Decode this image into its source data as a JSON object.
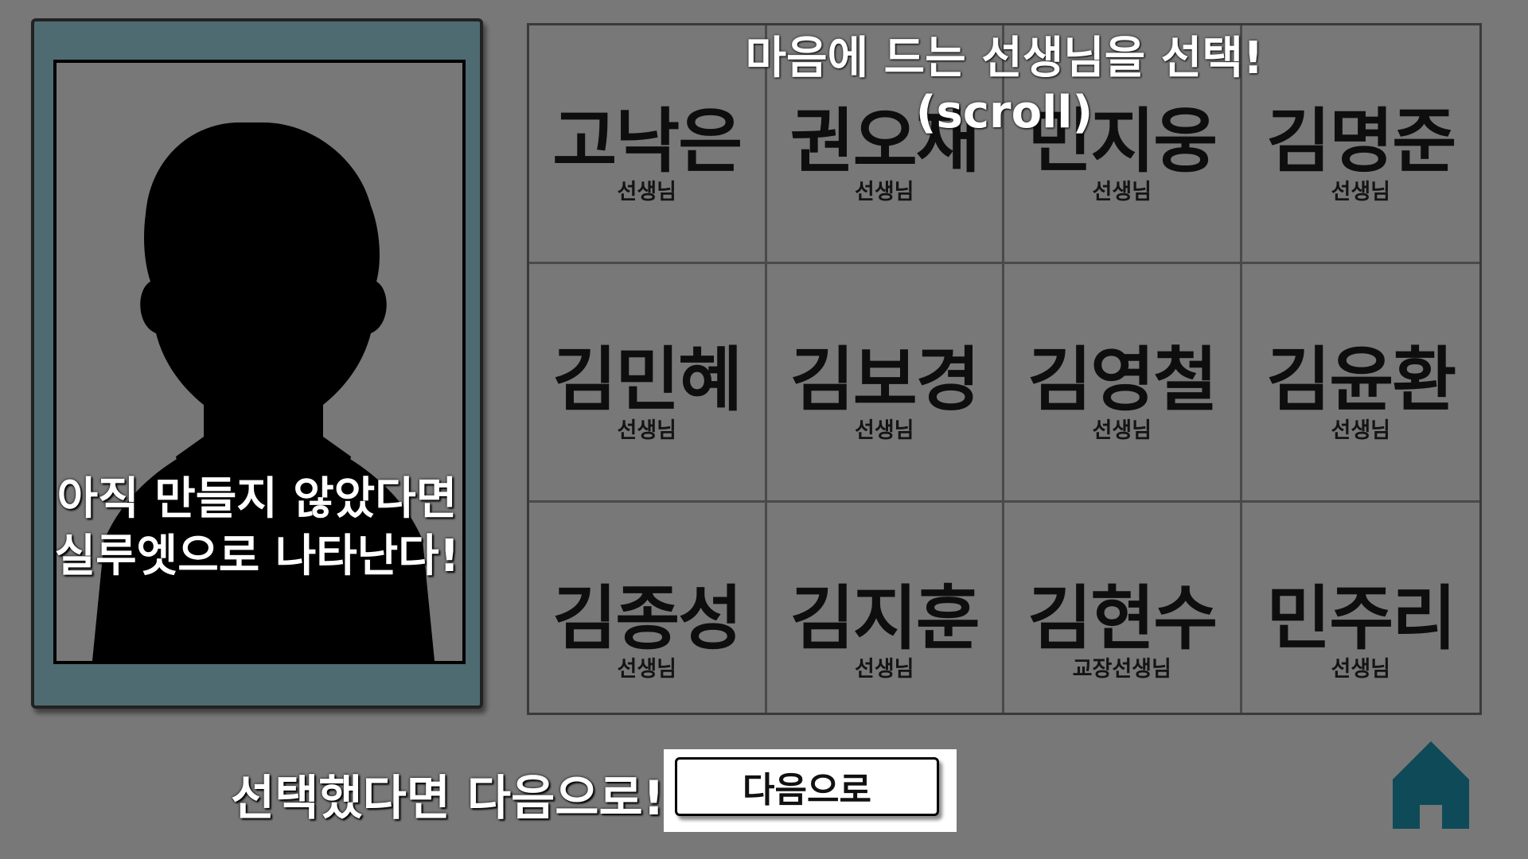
{
  "portrait": {
    "note_lines": [
      "아직 만들지 않았다면",
      "실루엣으로 나타난다!"
    ],
    "frame_color": "#4f6b72"
  },
  "header": {
    "line1": "마음에 드는 선생님을 선택!",
    "line2": "(scroll)"
  },
  "teachers": [
    {
      "name": "고낙은",
      "title": "선생님"
    },
    {
      "name": "권오재",
      "title": "선생님"
    },
    {
      "name": "민지웅",
      "title": "선생님"
    },
    {
      "name": "김명준",
      "title": "선생님"
    },
    {
      "name": "김민혜",
      "title": "선생님"
    },
    {
      "name": "김보경",
      "title": "선생님"
    },
    {
      "name": "김영철",
      "title": "선생님"
    },
    {
      "name": "김윤환",
      "title": "선생님"
    },
    {
      "name": "김종성",
      "title": "선생님"
    },
    {
      "name": "김지훈",
      "title": "선생님"
    },
    {
      "name": "김현수",
      "title": "교장선생님"
    },
    {
      "name": "민주리",
      "title": "선생님"
    }
  ],
  "footer": {
    "prompt": "선택했다면 다음으로!",
    "next_label": "다음으로",
    "home_icon": "home-icon",
    "home_color": "#0f4a58"
  }
}
